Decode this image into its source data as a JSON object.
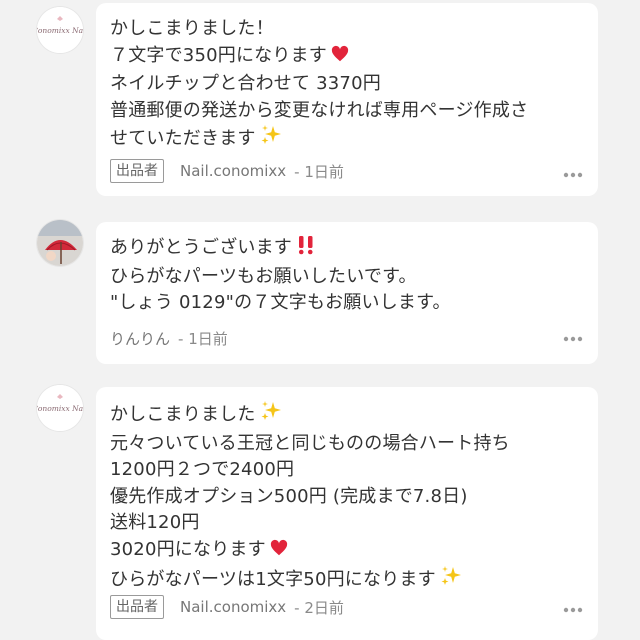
{
  "comments": [
    {
      "avatar": "conomixx-nail-logo",
      "lines": [
        "かしこまりました！",
        "７文字で350円になります",
        "ネイルチップと合わせて 3370円",
        "普通郵便の発送から変更なければ専用ページ作成さ",
        "せていただきます"
      ],
      "emojis": [
        "",
        "red-heart-emoji",
        "",
        "",
        "sparkles-emoji"
      ],
      "seller_badge": "出品者",
      "user": "Nail.conomixx",
      "time": "- 1日前"
    },
    {
      "avatar": "user-photo-red-umbrella",
      "lines": [
        "ありがとうございます",
        "ひらがなパーツもお願いしたいです。",
        "\"しょう 0129\"の７文字もお願いします。"
      ],
      "emojis": [
        "double-exclamation-emoji",
        "",
        ""
      ],
      "seller_badge": "",
      "user": "りんりん",
      "time": "- 1日前"
    },
    {
      "avatar": "conomixx-nail-logo",
      "lines": [
        "かしこまりました",
        "元々ついている王冠と同じものの場合ハート持ち",
        "1200円２つで2400円",
        "優先作成オプション500円 (完成まで7.8日)",
        "送料120円",
        "3020円になります",
        "ひらがなパーツは1文字50円になります"
      ],
      "emojis": [
        "sparkles-emoji",
        "",
        "",
        "",
        "",
        "red-heart-emoji",
        "sparkles-emoji"
      ],
      "seller_badge": "出品者",
      "user": "Nail.conomixx",
      "time": "- 2日前"
    }
  ],
  "logo_text": "Conomixx Nail",
  "colors": {
    "background": "#f2f2f2",
    "bubble": "#ffffff",
    "heart": "#e2243b",
    "sparkle": "#f5c518",
    "muted": "#8a8a8a"
  }
}
